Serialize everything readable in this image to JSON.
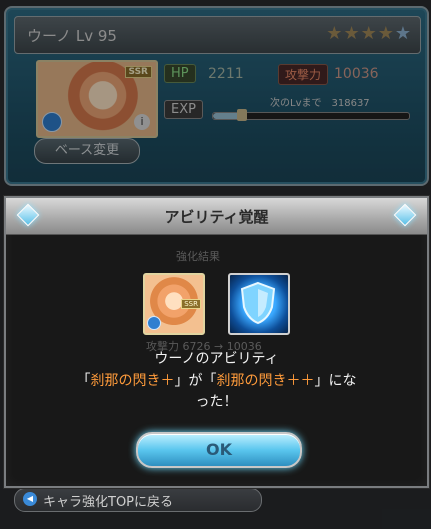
{
  "character_card": {
    "name_level": "ウーノ Lv 95",
    "stars": {
      "filled": 4,
      "total": 5
    },
    "rarity_badge": "SSR",
    "hp_label": "HP",
    "hp_value": "2211",
    "atk_label": "攻撃力",
    "atk_value": "10036",
    "exp_label": "EXP",
    "exp_next_text": "次のLvまで　318637",
    "exp_progress": 0.15,
    "base_change_button": "ベース変更"
  },
  "background_ghost": {
    "line1": "強化結果",
    "line2": "攻撃力 6726 → 10036"
  },
  "modal": {
    "title": "アビリティ覚醒",
    "char_icon_badge": "SSR",
    "message_line1": "ウーノのアビリティ",
    "msg_open1": "「",
    "ability_before": "刹那の閃き＋",
    "msg_mid": "」が「",
    "ability_after": "刹那の閃き＋＋",
    "msg_close": "」にな",
    "message_line3": "った！",
    "ok_button": "OK"
  },
  "bottom_nav": {
    "label": "キャラ強化TOPに戻る"
  },
  "colors": {
    "highlight": "#ff9b3b",
    "ok_button": "#5ac6ee",
    "card_bg": "#1f5268"
  }
}
